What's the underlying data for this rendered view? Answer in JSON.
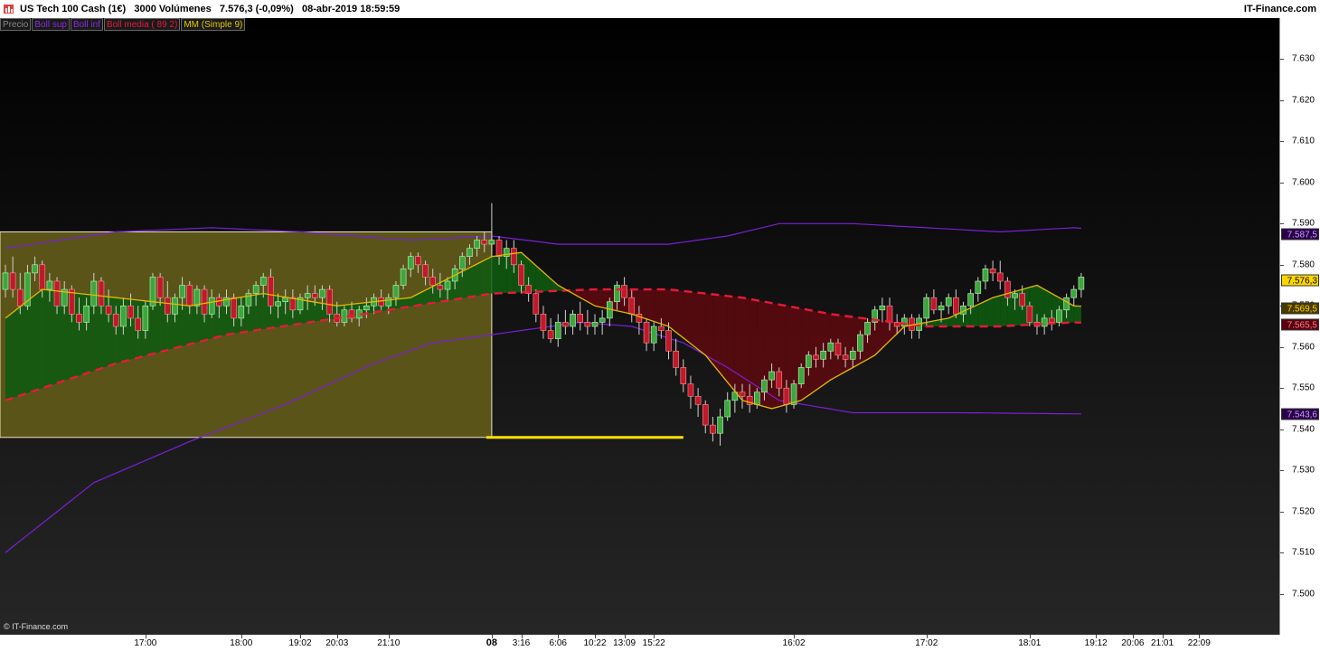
{
  "header": {
    "title": "US Tech 100 Cash (1€)   3000 Volúmenes   7.576,3 (-0,09%)   08-abr-2019 18:59:59",
    "brand": "IT-Finance.com"
  },
  "legend": [
    {
      "label": "Precio",
      "color": "#888888"
    },
    {
      "label": "Boll sup",
      "color": "#8a2be2"
    },
    {
      "label": "Boll inf",
      "color": "#8a2be2"
    },
    {
      "label": "Boll media ( 89 2)",
      "color": "#e8193a"
    },
    {
      "label": "MM (Simple 9)",
      "color": "#e6c800"
    }
  ],
  "copyright": "© IT-Finance.com",
  "colors": {
    "up_candle": "#3fa63f",
    "down_candle": "#c0192b",
    "boll_band": "#7b1fd6",
    "boll_mid": "#e8193a",
    "sma": "#e6b800",
    "zone": "#5a5418",
    "yellow_line": "#ffe000"
  },
  "price_tags": [
    {
      "value": "7.587,5",
      "bg": "#2a004a",
      "fg": "#c89cff"
    },
    {
      "value": "7.576,3",
      "bg": "#ffd700",
      "fg": "#000000"
    },
    {
      "value": "7.569,5",
      "bg": "#4a3a00",
      "fg": "#ffd700"
    },
    {
      "value": "7.565,5",
      "bg": "#5a0010",
      "fg": "#ff8080"
    },
    {
      "value": "7.543,6",
      "bg": "#2a004a",
      "fg": "#c89cff"
    }
  ],
  "chart_data": {
    "type": "candlestick",
    "ylim": [
      7490,
      7640
    ],
    "yticks": [
      "7.500",
      "7.510",
      "7.520",
      "7.530",
      "7.540",
      "7.550",
      "7.560",
      "7.570",
      "7.580",
      "7.590",
      "7.600",
      "7.610",
      "7.620",
      "7.630"
    ],
    "xticks": [
      {
        "label": "17:00",
        "idx": 19
      },
      {
        "label": "18:00",
        "idx": 32
      },
      {
        "label": "19:02",
        "idx": 40
      },
      {
        "label": "20:03",
        "idx": 45
      },
      {
        "label": "21:10",
        "idx": 52
      },
      {
        "label": "08",
        "idx": 66,
        "bold": true
      },
      {
        "label": "3:16",
        "idx": 70
      },
      {
        "label": "6:06",
        "idx": 75
      },
      {
        "label": "10:22",
        "idx": 80
      },
      {
        "label": "13:09",
        "idx": 84
      },
      {
        "label": "15:22",
        "idx": 88
      },
      {
        "label": "16:02",
        "idx": 107
      },
      {
        "label": "17:02",
        "idx": 125
      },
      {
        "label": "18:01",
        "idx": 139
      },
      {
        "label": "19:12",
        "idx": 148
      },
      {
        "label": "20:06",
        "idx": 153
      },
      {
        "label": "21:01",
        "idx": 157
      },
      {
        "label": "22:09",
        "idx": 162
      }
    ],
    "candles": [
      [
        7574,
        7580,
        7572,
        7578
      ],
      [
        7578,
        7582,
        7572,
        7574
      ],
      [
        7574,
        7578,
        7568,
        7570
      ],
      [
        7570,
        7580,
        7569,
        7578
      ],
      [
        7578,
        7582,
        7576,
        7580
      ],
      [
        7580,
        7581,
        7572,
        7574
      ],
      [
        7574,
        7578,
        7571,
        7576
      ],
      [
        7576,
        7577,
        7568,
        7570
      ],
      [
        7570,
        7576,
        7568,
        7574
      ],
      [
        7574,
        7575,
        7566,
        7568
      ],
      [
        7568,
        7572,
        7564,
        7566
      ],
      [
        7566,
        7572,
        7564,
        7570
      ],
      [
        7570,
        7578,
        7568,
        7576
      ],
      [
        7576,
        7577,
        7568,
        7570
      ],
      [
        7570,
        7574,
        7566,
        7568
      ],
      [
        7568,
        7570,
        7563,
        7565
      ],
      [
        7565,
        7572,
        7563,
        7570
      ],
      [
        7570,
        7573,
        7565,
        7567
      ],
      [
        7567,
        7570,
        7562,
        7564
      ],
      [
        7564,
        7571,
        7562,
        7570
      ],
      [
        7570,
        7578,
        7569,
        7577
      ],
      [
        7577,
        7578,
        7570,
        7572
      ],
      [
        7572,
        7576,
        7566,
        7568
      ],
      [
        7568,
        7573,
        7566,
        7572
      ],
      [
        7572,
        7577,
        7569,
        7575
      ],
      [
        7575,
        7576,
        7568,
        7570
      ],
      [
        7570,
        7575,
        7568,
        7574
      ],
      [
        7574,
        7575,
        7566,
        7568
      ],
      [
        7568,
        7574,
        7567,
        7572
      ],
      [
        7572,
        7573,
        7567,
        7570
      ],
      [
        7570,
        7574,
        7568,
        7572
      ],
      [
        7572,
        7573,
        7565,
        7567
      ],
      [
        7567,
        7572,
        7565,
        7570
      ],
      [
        7570,
        7574,
        7568,
        7573
      ],
      [
        7573,
        7576,
        7570,
        7575
      ],
      [
        7575,
        7578,
        7572,
        7577
      ],
      [
        7577,
        7579,
        7568,
        7570
      ],
      [
        7570,
        7573,
        7567,
        7571
      ],
      [
        7571,
        7574,
        7568,
        7572
      ],
      [
        7572,
        7574,
        7567,
        7569
      ],
      [
        7569,
        7573,
        7568,
        7572
      ],
      [
        7572,
        7575,
        7569,
        7573
      ],
      [
        7573,
        7575,
        7570,
        7572
      ],
      [
        7572,
        7575,
        7569,
        7574
      ],
      [
        7574,
        7575,
        7566,
        7568
      ],
      [
        7568,
        7571,
        7565,
        7566
      ],
      [
        7566,
        7570,
        7565,
        7569
      ],
      [
        7569,
        7571,
        7566,
        7567
      ],
      [
        7567,
        7570,
        7565,
        7569
      ],
      [
        7569,
        7572,
        7567,
        7570
      ],
      [
        7570,
        7573,
        7568,
        7572
      ],
      [
        7572,
        7574,
        7569,
        7570
      ],
      [
        7570,
        7573,
        7568,
        7572
      ],
      [
        7572,
        7576,
        7570,
        7575
      ],
      [
        7575,
        7580,
        7574,
        7579
      ],
      [
        7579,
        7583,
        7577,
        7582
      ],
      [
        7582,
        7583,
        7578,
        7580
      ],
      [
        7580,
        7581,
        7575,
        7577
      ],
      [
        7577,
        7579,
        7573,
        7575
      ],
      [
        7575,
        7578,
        7572,
        7574
      ],
      [
        7574,
        7577,
        7571,
        7576
      ],
      [
        7576,
        7580,
        7574,
        7579
      ],
      [
        7579,
        7583,
        7577,
        7582
      ],
      [
        7582,
        7585,
        7580,
        7584
      ],
      [
        7584,
        7587,
        7582,
        7586
      ],
      [
        7586,
        7588,
        7583,
        7585
      ],
      [
        7585,
        7595,
        7583,
        7586
      ],
      [
        7586,
        7587,
        7580,
        7582
      ],
      [
        7582,
        7586,
        7579,
        7584
      ],
      [
        7584,
        7586,
        7578,
        7580
      ],
      [
        7580,
        7581,
        7573,
        7575
      ],
      [
        7575,
        7577,
        7571,
        7573
      ],
      [
        7573,
        7574,
        7566,
        7568
      ],
      [
        7568,
        7570,
        7562,
        7564
      ],
      [
        7564,
        7567,
        7561,
        7562
      ],
      [
        7562,
        7568,
        7560,
        7566
      ],
      [
        7566,
        7569,
        7563,
        7565
      ],
      [
        7565,
        7569,
        7563,
        7568
      ],
      [
        7568,
        7571,
        7564,
        7566
      ],
      [
        7566,
        7569,
        7563,
        7565
      ],
      [
        7565,
        7568,
        7563,
        7566
      ],
      [
        7566,
        7569,
        7563,
        7567
      ],
      [
        7567,
        7572,
        7565,
        7571
      ],
      [
        7571,
        7576,
        7569,
        7575
      ],
      [
        7575,
        7577,
        7570,
        7572
      ],
      [
        7572,
        7574,
        7566,
        7568
      ],
      [
        7568,
        7570,
        7563,
        7566
      ],
      [
        7566,
        7567,
        7559,
        7561
      ],
      [
        7561,
        7566,
        7559,
        7565
      ],
      [
        7565,
        7567,
        7562,
        7564
      ],
      [
        7564,
        7566,
        7557,
        7559
      ],
      [
        7559,
        7562,
        7553,
        7555
      ],
      [
        7555,
        7557,
        7549,
        7551
      ],
      [
        7551,
        7553,
        7545,
        7548
      ],
      [
        7548,
        7550,
        7543,
        7546
      ],
      [
        7546,
        7547,
        7539,
        7541
      ],
      [
        7541,
        7543,
        7537,
        7539
      ],
      [
        7539,
        7545,
        7536,
        7543
      ],
      [
        7543,
        7549,
        7542,
        7547
      ],
      [
        7547,
        7551,
        7544,
        7549
      ],
      [
        7549,
        7551,
        7545,
        7548
      ],
      [
        7548,
        7551,
        7544,
        7546
      ],
      [
        7546,
        7550,
        7545,
        7549
      ],
      [
        7549,
        7553,
        7547,
        7552
      ],
      [
        7552,
        7556,
        7550,
        7554
      ],
      [
        7554,
        7555,
        7548,
        7550
      ],
      [
        7550,
        7552,
        7544,
        7546
      ],
      [
        7546,
        7552,
        7545,
        7551
      ],
      [
        7551,
        7556,
        7550,
        7555
      ],
      [
        7555,
        7559,
        7553,
        7558
      ],
      [
        7558,
        7560,
        7555,
        7557
      ],
      [
        7557,
        7561,
        7555,
        7559
      ],
      [
        7559,
        7562,
        7557,
        7561
      ],
      [
        7561,
        7562,
        7557,
        7558
      ],
      [
        7558,
        7560,
        7555,
        7557
      ],
      [
        7557,
        7560,
        7555,
        7559
      ],
      [
        7559,
        7564,
        7557,
        7563
      ],
      [
        7563,
        7567,
        7561,
        7566
      ],
      [
        7566,
        7570,
        7564,
        7569
      ],
      [
        7569,
        7572,
        7566,
        7570
      ],
      [
        7570,
        7572,
        7564,
        7566
      ],
      [
        7566,
        7568,
        7563,
        7565
      ],
      [
        7565,
        7568,
        7563,
        7567
      ],
      [
        7567,
        7568,
        7562,
        7564
      ],
      [
        7564,
        7568,
        7562,
        7567
      ],
      [
        7567,
        7573,
        7565,
        7572
      ],
      [
        7572,
        7574,
        7568,
        7569
      ],
      [
        7569,
        7571,
        7566,
        7570
      ],
      [
        7570,
        7573,
        7568,
        7572
      ],
      [
        7572,
        7574,
        7567,
        7568
      ],
      [
        7568,
        7571,
        7566,
        7570
      ],
      [
        7570,
        7574,
        7568,
        7573
      ],
      [
        7573,
        7577,
        7571,
        7576
      ],
      [
        7576,
        7580,
        7574,
        7579
      ],
      [
        7579,
        7581,
        7576,
        7578
      ],
      [
        7578,
        7581,
        7574,
        7576
      ],
      [
        7576,
        7577,
        7570,
        7572
      ],
      [
        7572,
        7574,
        7569,
        7573
      ],
      [
        7573,
        7575,
        7569,
        7570
      ],
      [
        7570,
        7571,
        7565,
        7566
      ],
      [
        7566,
        7568,
        7563,
        7565
      ],
      [
        7565,
        7568,
        7563,
        7567
      ],
      [
        7567,
        7569,
        7564,
        7566
      ],
      [
        7566,
        7570,
        7565,
        7569
      ],
      [
        7569,
        7573,
        7567,
        7572
      ],
      [
        7572,
        7575,
        7570,
        7574
      ],
      [
        7574,
        7578,
        7572,
        7577
      ]
    ],
    "boll_sup": [
      [
        0,
        7584
      ],
      [
        15,
        7588
      ],
      [
        28,
        7589
      ],
      [
        40,
        7588
      ],
      [
        55,
        7586
      ],
      [
        66,
        7587
      ],
      [
        75,
        7585
      ],
      [
        90,
        7585
      ],
      [
        98,
        7587
      ],
      [
        105,
        7590
      ],
      [
        115,
        7590
      ],
      [
        125,
        7589
      ],
      [
        135,
        7588
      ],
      [
        145,
        7589
      ],
      [
        152,
        7588
      ]
    ],
    "boll_inf": [
      [
        0,
        7510
      ],
      [
        12,
        7527
      ],
      [
        25,
        7537
      ],
      [
        38,
        7546
      ],
      [
        50,
        7556
      ],
      [
        58,
        7561
      ],
      [
        66,
        7563
      ],
      [
        78,
        7566
      ],
      [
        85,
        7565
      ],
      [
        92,
        7561
      ],
      [
        98,
        7555
      ],
      [
        105,
        7547
      ],
      [
        115,
        7544
      ],
      [
        130,
        7544
      ],
      [
        152,
        7543.6
      ]
    ],
    "boll_mid": [
      [
        0,
        7547
      ],
      [
        15,
        7556
      ],
      [
        30,
        7563
      ],
      [
        45,
        7567
      ],
      [
        66,
        7573
      ],
      [
        80,
        7574
      ],
      [
        90,
        7574
      ],
      [
        100,
        7572
      ],
      [
        112,
        7568
      ],
      [
        125,
        7565
      ],
      [
        135,
        7565
      ],
      [
        145,
        7566
      ],
      [
        152,
        7565.5
      ]
    ],
    "sma": [
      [
        0,
        7567
      ],
      [
        5,
        7574
      ],
      [
        15,
        7572
      ],
      [
        25,
        7570
      ],
      [
        35,
        7573
      ],
      [
        45,
        7570
      ],
      [
        55,
        7572
      ],
      [
        66,
        7582
      ],
      [
        70,
        7583
      ],
      [
        75,
        7575
      ],
      [
        80,
        7570
      ],
      [
        85,
        7568
      ],
      [
        90,
        7565
      ],
      [
        95,
        7558
      ],
      [
        100,
        7547
      ],
      [
        104,
        7545
      ],
      [
        108,
        7547
      ],
      [
        112,
        7552
      ],
      [
        118,
        7558
      ],
      [
        122,
        7565
      ],
      [
        128,
        7567
      ],
      [
        134,
        7572
      ],
      [
        140,
        7575
      ],
      [
        145,
        7570
      ],
      [
        152,
        7569.5
      ]
    ],
    "zone": {
      "x_start_idx": 0,
      "x_end_idx": 66,
      "y_top": 7588,
      "y_bottom": 7538
    },
    "yellow_line": {
      "x_start_idx": 66,
      "x_end_idx": 92,
      "y": 7538
    }
  }
}
